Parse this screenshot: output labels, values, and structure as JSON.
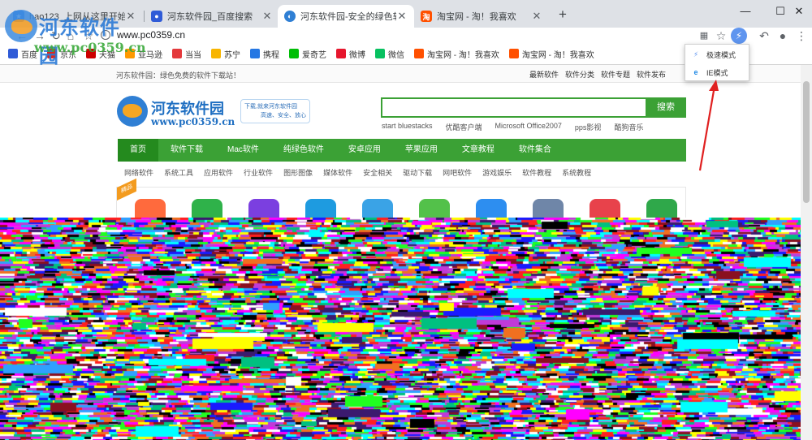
{
  "tabs": [
    {
      "title": "hao123_上网从这里开始",
      "favicon": "star",
      "favicon_color": "#3f86e0",
      "active": false
    },
    {
      "title": "河东软件园_百度搜索",
      "favicon": "paw",
      "favicon_color": "#2f5bd7",
      "active": false
    },
    {
      "title": "河东软件园-安全的绿色软件下载",
      "favicon": "hedong-logo",
      "favicon_color": "#2f7fd4",
      "active": true
    },
    {
      "title": "淘宝网 - 淘！我喜欢",
      "favicon": "taobao",
      "favicon_color": "#ff5000",
      "active": false
    }
  ],
  "tab_close": "✕",
  "new_tab_label": "+",
  "window_controls": {
    "minimize": "—",
    "maximize": "☐",
    "close": "✕"
  },
  "toolbar": {
    "url": "www.pc0359.cn",
    "icons": [
      "back-icon",
      "forward-icon",
      "reload-icon",
      "home-icon",
      "star-icon",
      "info-icon",
      "apps-icon",
      "bookmark-star-icon",
      "flash-mode-icon",
      "undo-icon",
      "account-icon",
      "menu-icon"
    ]
  },
  "bookmarks": [
    {
      "label": "百度",
      "icon": "baidu",
      "color": "#2f5bd7"
    },
    {
      "label": "京东",
      "icon": "jd",
      "color": "#e1251b"
    },
    {
      "label": "天猫",
      "icon": "tmall",
      "color": "#c00"
    },
    {
      "label": "亚马逊",
      "icon": "amazon",
      "color": "#ff9900"
    },
    {
      "label": "当当",
      "icon": "dangdang",
      "color": "#e4393c"
    },
    {
      "label": "苏宁",
      "icon": "suning",
      "color": "#f8b500"
    },
    {
      "label": "携程",
      "icon": "ctrip",
      "color": "#2577e3"
    },
    {
      "label": "爱奇艺",
      "icon": "iqiyi",
      "color": "#00be06"
    },
    {
      "label": "微博",
      "icon": "weibo",
      "color": "#e6162d"
    },
    {
      "label": "微信",
      "icon": "wechat",
      "color": "#07c160"
    },
    {
      "label": "淘宝网 - 淘！我喜欢",
      "icon": "taobao",
      "color": "#ff5000"
    },
    {
      "label": "淘宝网 - 淘！我喜欢",
      "icon": "taobao",
      "color": "#ff5000"
    }
  ],
  "watermark": {
    "title": "河东软件园",
    "url": "www.pc0359.cn"
  },
  "mode_menu": {
    "items": [
      {
        "label": "极速模式",
        "icon": "⚡",
        "icon_color": "#5f95ef"
      },
      {
        "label": "IE模式",
        "icon": "e",
        "icon_color": "#1e88e5"
      }
    ]
  },
  "page": {
    "tagline": "河东软件园：绿色免费的软件下载站！",
    "top_links": [
      "最新软件",
      "软件分类",
      "软件专题",
      "软件发布"
    ],
    "logo_name": "河东软件园",
    "logo_url": "www.pc0359.cn",
    "slogan_line1": "下载,就来河东软件园",
    "slogan_line2": "高速、安全、放心",
    "search_button": "搜索",
    "search_value": "",
    "hot_words": [
      "start bluestacks",
      "优酷客户端",
      "Microsoft Office2007",
      "pps影视",
      "酷狗音乐"
    ],
    "main_nav": [
      "首页",
      "软件下载",
      "Mac软件",
      "纯绿色软件",
      "安卓应用",
      "苹果应用",
      "文章教程",
      "软件集合"
    ],
    "sub_nav": [
      "网络软件",
      "系统工具",
      "应用软件",
      "行业软件",
      "图形图像",
      "媒体软件",
      "安全相关",
      "驱动下载",
      "网吧软件",
      "游戏娱乐",
      "软件教程",
      "系统教程"
    ],
    "ribbon": "精品",
    "app_icon_colors": [
      "#ff6a3d",
      "#2fb24a",
      "#7b3fe0",
      "#1e9be0",
      "#3aa3e6",
      "#53c14a",
      "#2d8ef0",
      "#6f86a8",
      "#e8424b",
      "#2fa84a"
    ]
  },
  "colors": {
    "accent": "#3ba135",
    "accent_dark": "#248a1e",
    "brand_blue": "#1f6fc2"
  }
}
